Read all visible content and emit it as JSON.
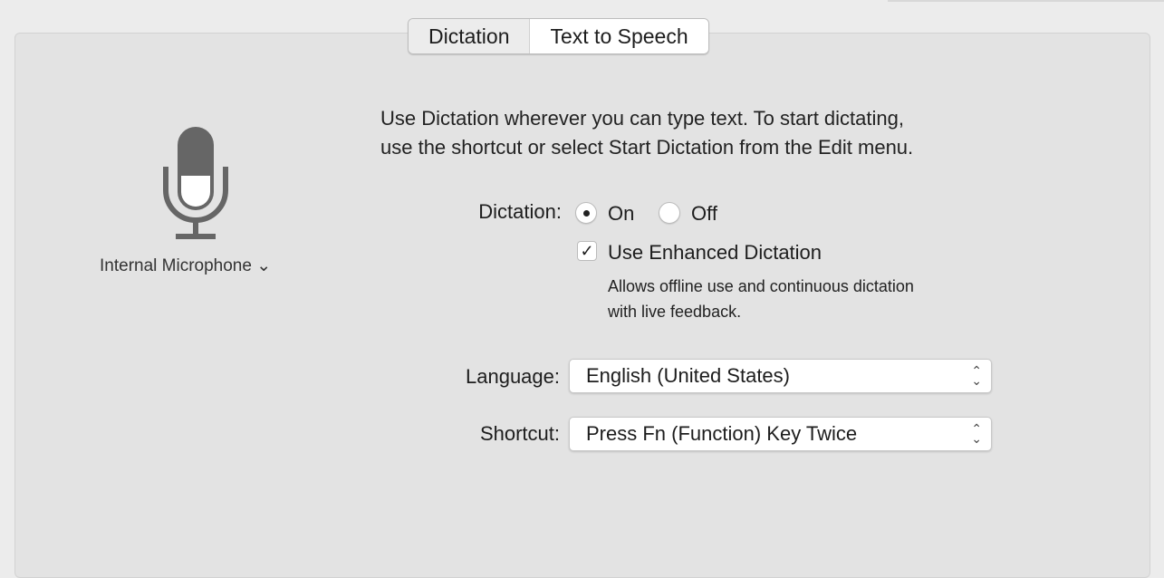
{
  "tabs": [
    {
      "label": "Dictation",
      "selected": false
    },
    {
      "label": "Text to Speech",
      "selected": true
    }
  ],
  "microphone": {
    "icon": "microphone-icon",
    "source": "Internal Microphone",
    "chevron": "⌄"
  },
  "description": [
    "Use Dictation wherever you can type text. To start dictating,",
    "use the shortcut or select Start Dictation from the Edit menu."
  ],
  "dictation": {
    "label": "Dictation:",
    "options": [
      {
        "label": "On",
        "selected": true
      },
      {
        "label": "Off",
        "selected": false
      }
    ]
  },
  "enhanced": {
    "label": "Use Enhanced Dictation",
    "checked": true,
    "check": "✓",
    "help": [
      "Allows offline use and continuous dictation",
      "with live feedback."
    ]
  },
  "language": {
    "label": "Language:",
    "value": "English (United States)"
  },
  "shortcut": {
    "label": "Shortcut:",
    "value": "Press Fn (Function) Key Twice"
  },
  "arrows": {
    "up": "⌃",
    "down": "⌄"
  }
}
